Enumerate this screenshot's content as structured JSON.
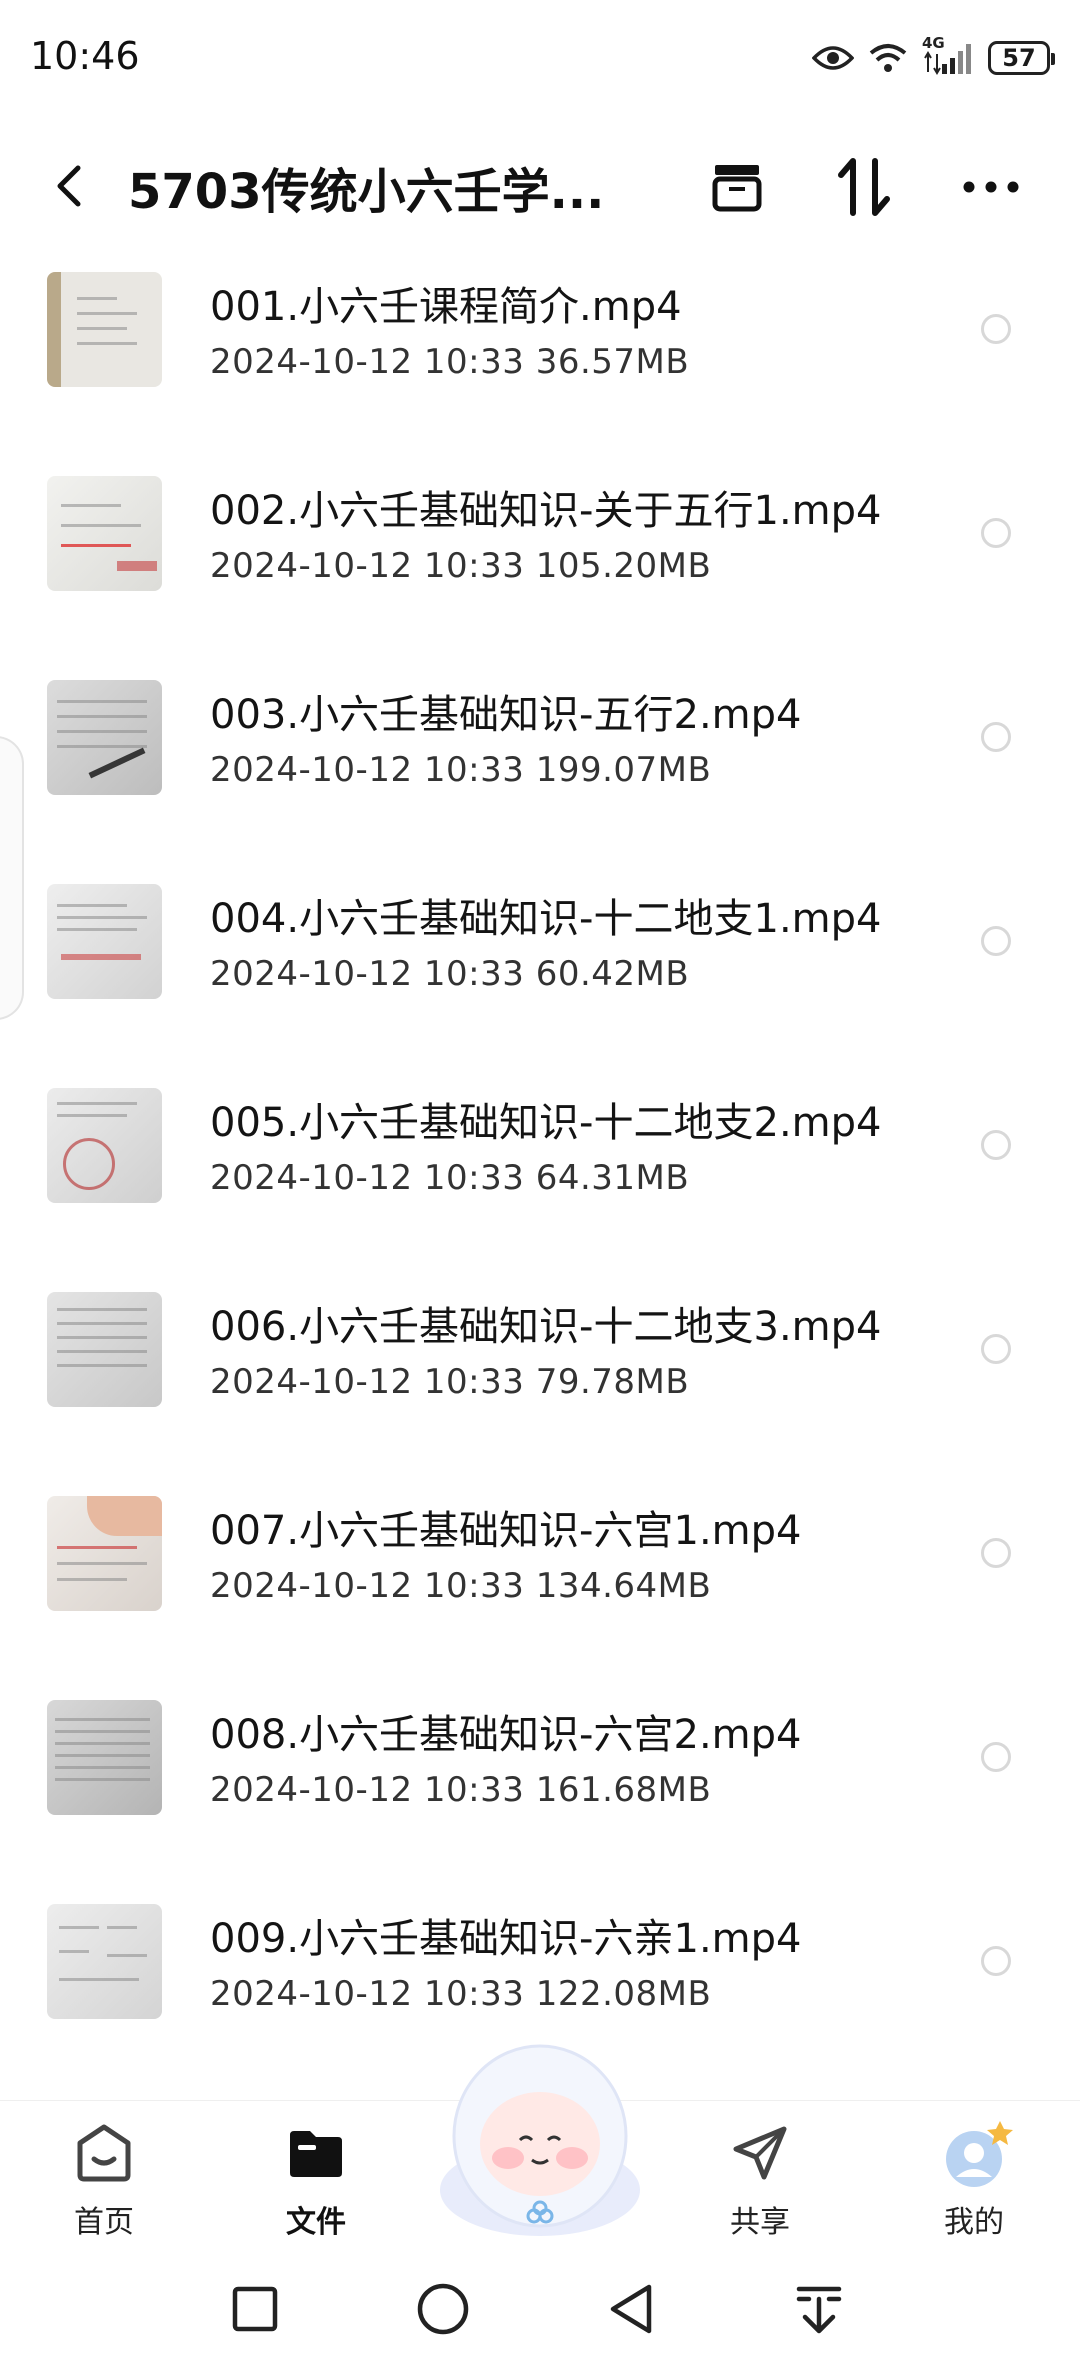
{
  "status_bar": {
    "time": "10:46",
    "network": "4G",
    "battery": "57",
    "icons": [
      "eye-icon",
      "wifi-icon",
      "signal-icon",
      "battery-icon"
    ]
  },
  "header": {
    "title": "5703传统小六壬学...",
    "icons": [
      "back-icon",
      "archive-icon",
      "sort-icon",
      "more-icon"
    ]
  },
  "files": [
    {
      "name": "001.小六壬课程简介.mp4",
      "meta": "2024-10-12  10:33  36.57MB"
    },
    {
      "name": "002.小六壬基础知识-关于五行1.mp4",
      "meta": "2024-10-12  10:33  105.20MB"
    },
    {
      "name": "003.小六壬基础知识-五行2.mp4",
      "meta": "2024-10-12  10:33  199.07MB"
    },
    {
      "name": "004.小六壬基础知识-十二地支1.mp4",
      "meta": "2024-10-12  10:33  60.42MB"
    },
    {
      "name": "005.小六壬基础知识-十二地支2.mp4",
      "meta": "2024-10-12  10:33  64.31MB"
    },
    {
      "name": "006.小六壬基础知识-十二地支3.mp4",
      "meta": "2024-10-12  10:33  79.78MB"
    },
    {
      "name": "007.小六壬基础知识-六宫1.mp4",
      "meta": "2024-10-12  10:33  134.64MB"
    },
    {
      "name": "008.小六壬基础知识-六宫2.mp4",
      "meta": "2024-10-12  10:33  161.68MB"
    },
    {
      "name": "009.小六壬基础知识-六亲1.mp4",
      "meta": "2024-10-12  10:33  122.08MB"
    }
  ],
  "nav": {
    "home": "首页",
    "files": "文件",
    "share": "共享",
    "mine": "我的",
    "active": "files"
  },
  "system_nav": [
    "square-icon",
    "circle-icon",
    "triangle-back-icon",
    "download-menu-icon"
  ]
}
